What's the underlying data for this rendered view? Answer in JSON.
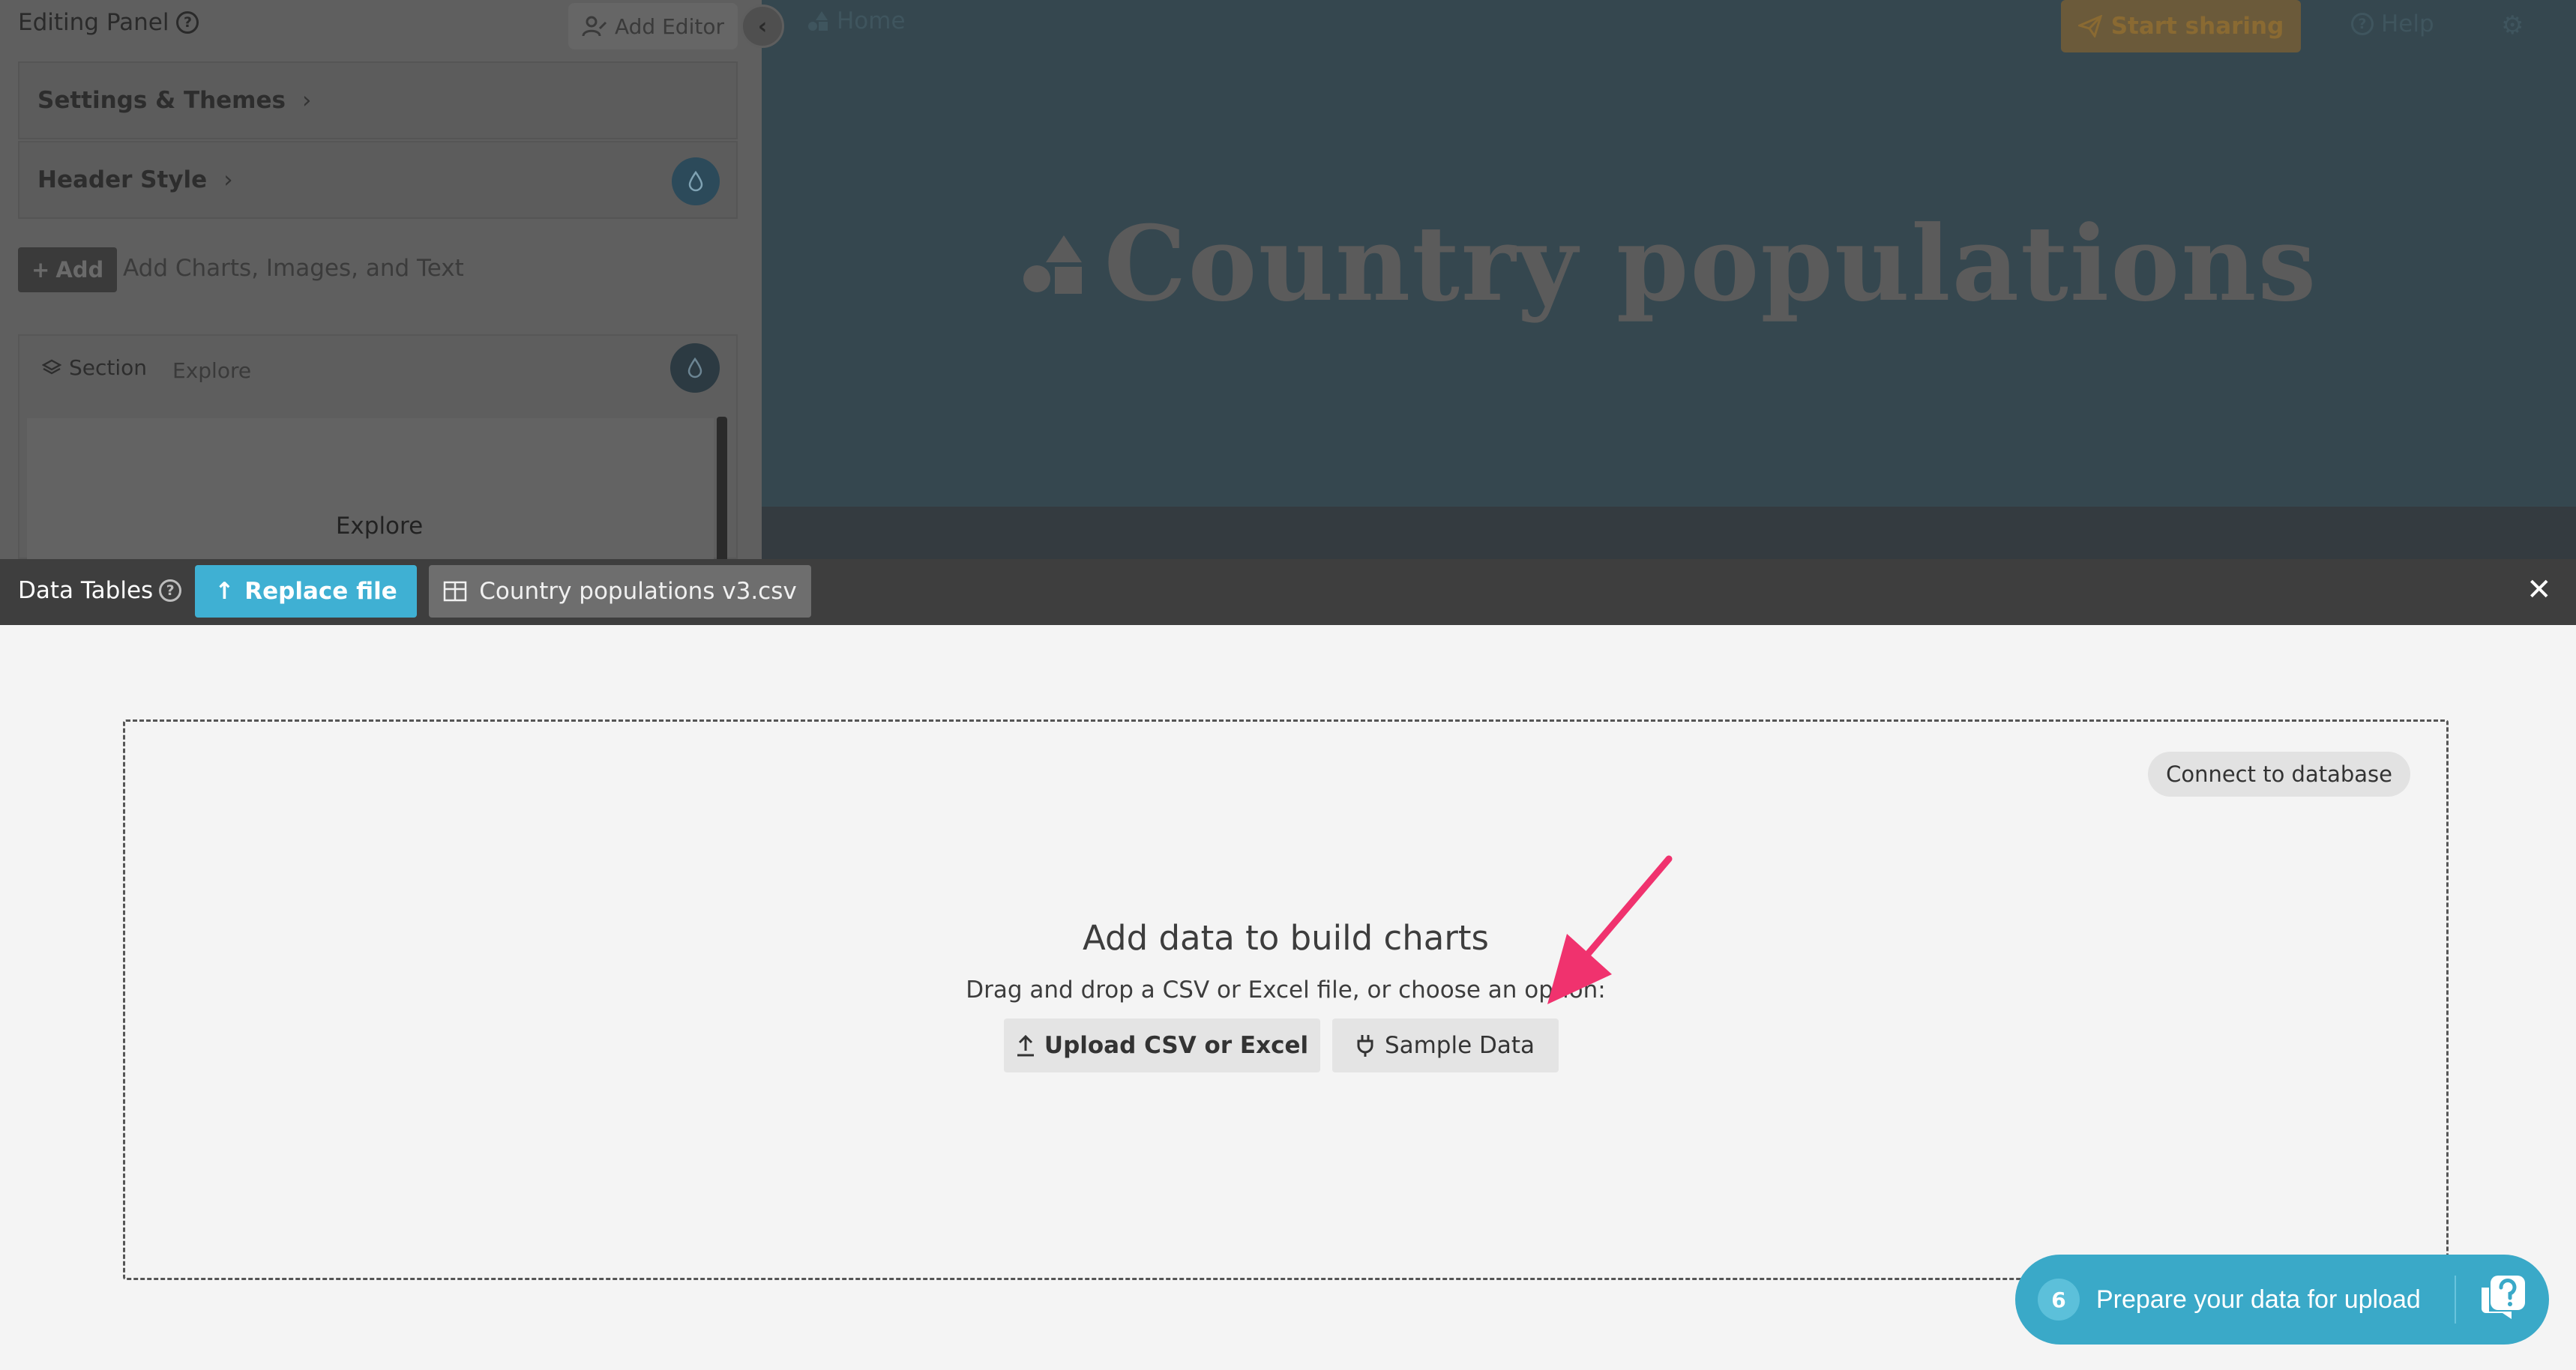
{
  "editing_panel": {
    "title": "Editing Panel",
    "add_editor": "Add Editor",
    "settings_themes": "Settings & Themes",
    "header_style": "Header Style",
    "add_label": "Add",
    "add_hint": "Add Charts, Images, and Text",
    "section_tag": "Section",
    "section_name": "Explore",
    "section_content_title": "Explore"
  },
  "top_nav": {
    "home": "Home",
    "start_sharing": "Start sharing",
    "help": "Help"
  },
  "header": {
    "title": "Country populations"
  },
  "data_tables": {
    "title": "Data Tables",
    "replace_file": "Replace file",
    "file_name": "Country populations v3.csv"
  },
  "dropzone": {
    "connect": "Connect to database",
    "title": "Add data to build charts",
    "subtitle": "Drag and drop a CSV or Excel file, or choose an option:",
    "upload": "Upload CSV or Excel",
    "sample": "Sample Data"
  },
  "chat": {
    "badge": "6",
    "text": "Prepare your data for upload"
  },
  "colors": {
    "accent": "#3fb0d3",
    "arrow": "#f0326e",
    "chat": "#3aa9c8"
  }
}
